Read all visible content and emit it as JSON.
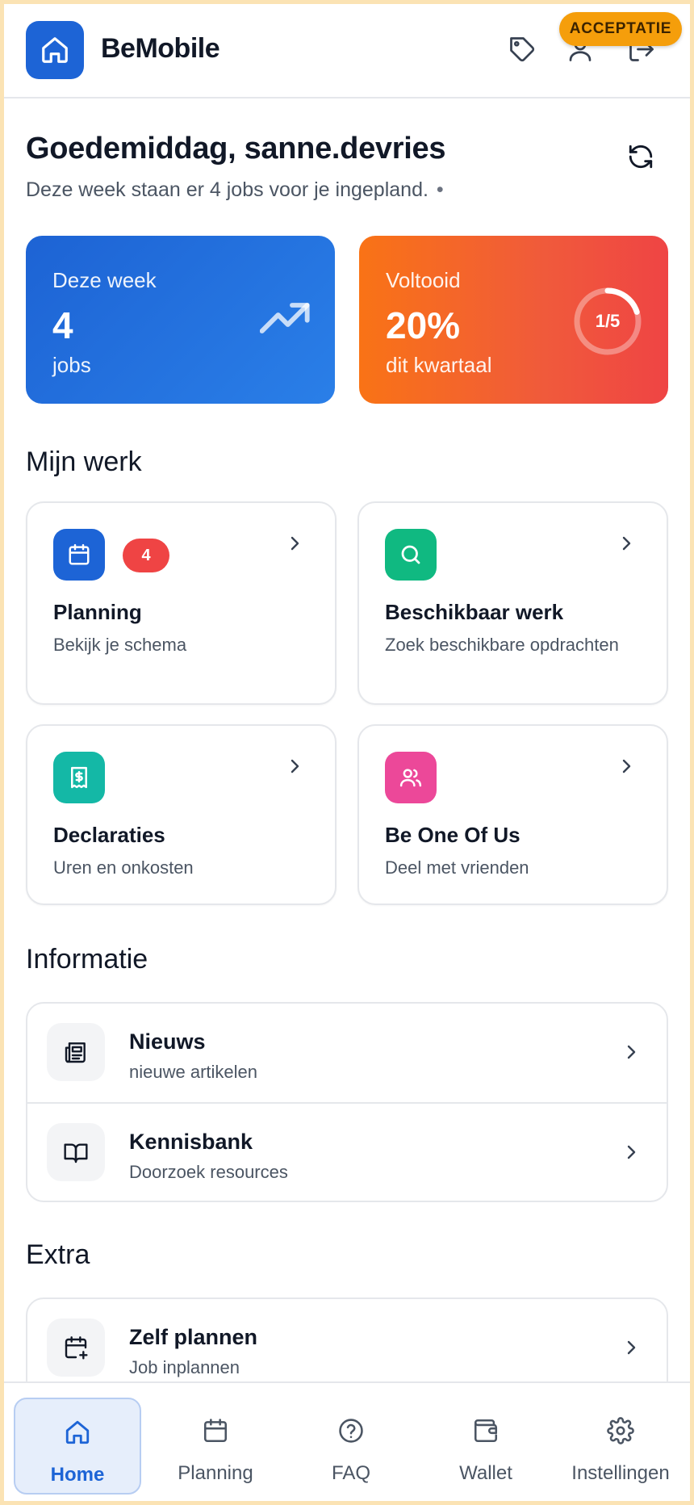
{
  "header": {
    "brand": "BeMobile",
    "env_badge": "ACCEPTATIE",
    "icons": [
      "tag-icon",
      "user-icon",
      "logout-icon"
    ],
    "logo_icon": "home-icon"
  },
  "greeting": {
    "title": "Goedemiddag, sanne.devries",
    "subtitle": "Deze week staan er 4 jobs voor je ingepland.",
    "dot": "•"
  },
  "stats": {
    "week": {
      "label": "Deze week",
      "value": "4",
      "unit": "jobs"
    },
    "completed": {
      "label": "Voltooid",
      "value": "20%",
      "unit": "dit kwartaal",
      "ring_text": "1/5",
      "progress": 0.2
    }
  },
  "sections": {
    "work": "Mijn werk",
    "info": "Informatie",
    "extra": "Extra"
  },
  "work_tiles": [
    {
      "title": "Planning",
      "subtitle": "Bekijk je schema",
      "badge": "4",
      "icon": "calendar-icon",
      "color": "#1d64d6"
    },
    {
      "title": "Beschikbaar werk",
      "subtitle": "Zoek beschikbare opdrachten",
      "icon": "search-icon",
      "color": "#10b981"
    },
    {
      "title": "Declaraties",
      "subtitle": "Uren en onkosten",
      "icon": "receipt-icon",
      "color": "#14b8a6"
    },
    {
      "title": "Be One Of Us",
      "subtitle": "Deel met vrienden",
      "icon": "users-icon",
      "color": "#ec4899"
    }
  ],
  "info_items": [
    {
      "title": "Nieuws",
      "subtitle": "nieuwe artikelen",
      "icon": "newspaper-icon"
    },
    {
      "title": "Kennisbank",
      "subtitle": "Doorzoek resources",
      "icon": "book-icon"
    }
  ],
  "extra_items": [
    {
      "title": "Zelf plannen",
      "subtitle": "Job inplannen",
      "icon": "calendar-plus-icon"
    }
  ],
  "nav": [
    {
      "label": "Home",
      "icon": "home-icon",
      "active": true
    },
    {
      "label": "Planning",
      "icon": "calendar-icon"
    },
    {
      "label": "FAQ",
      "icon": "help-circle-icon"
    },
    {
      "label": "Wallet",
      "icon": "wallet-icon"
    },
    {
      "label": "Instellingen",
      "icon": "gear-icon"
    }
  ]
}
